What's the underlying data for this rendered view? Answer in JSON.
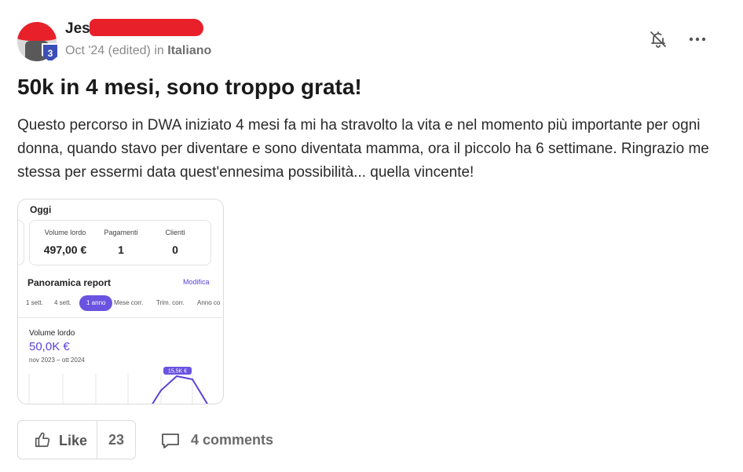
{
  "post": {
    "author_name": "Jes",
    "level": "3",
    "timestamp": "Oct '24 (edited)",
    "in_word": "in",
    "group": "Italiano",
    "title": "50k in 4 mesi, sono troppo grata!",
    "body": "Questo percorso in DWA iniziato 4 mesi fa mi ha stravolto la vita e nel momento più importante per ogni donna, quando stavo per diventare e sono diventata mamma, ora il piccolo ha 6 settimane. Ringrazio me stessa per essermi data quest'ennesima possibilità... quella vincente!"
  },
  "header_icons": {
    "bell": "bell-off-icon",
    "more": "more-horizontal-icon"
  },
  "attachment": {
    "today_heading": "Oggi",
    "stats": [
      {
        "label": "Volume lordo",
        "value": "497,00 €"
      },
      {
        "label": "Pagamenti",
        "value": "1"
      },
      {
        "label": "Clienti",
        "value": "0"
      }
    ],
    "report_heading": "Panoramica report",
    "edit_link": "Modifica",
    "tabs": [
      "1 sett.",
      "4 sett.",
      "1 anno",
      "Mese corr.",
      "Trim. corr.",
      "Anno co"
    ],
    "active_tab": "1 anno",
    "volume_label": "Volume lordo",
    "volume_value": "50,0K €",
    "range": "nov 2023 – ott 2024",
    "chart_tooltip": "15,5K €",
    "accent_color": "#6a53e0"
  },
  "actions": {
    "like_label": "Like",
    "like_count": "23",
    "comments_label": "4 comments"
  }
}
